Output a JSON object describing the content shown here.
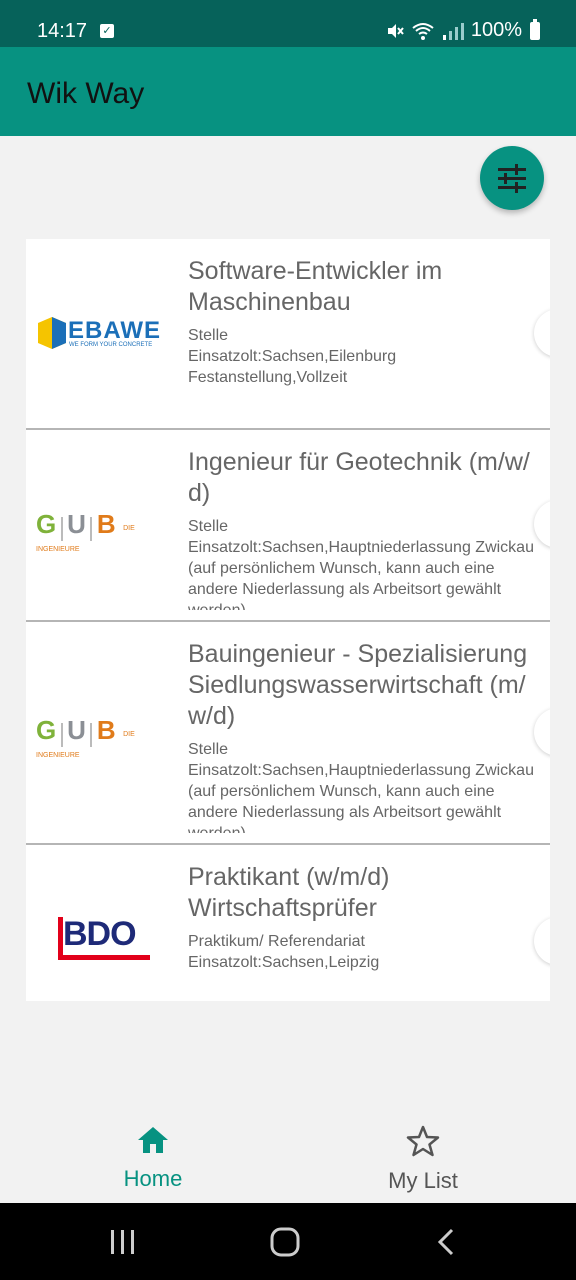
{
  "status": {
    "time": "14:17",
    "battery": "100%"
  },
  "app": {
    "title": "Wik Way"
  },
  "colors": {
    "primary": "#079281",
    "primary_dark": "#06625a"
  },
  "jobs": [
    {
      "title_lines": [
        "Software-Entwickler im",
        "Maschinenbau"
      ],
      "type": "Stelle",
      "location": "Einsatzolt:Sachsen,Eilenburg",
      "extra": [
        "Festanstellung,Vollzeit"
      ],
      "logo": {
        "name": "EBAWE",
        "tagline": "WE FORM YOUR CONCRETE"
      }
    },
    {
      "title_lines": [
        "Ingenieur für Geotechnik (m/w/",
        "d)"
      ],
      "type": "Stelle",
      "location": "Einsatzolt:Sachsen,Hauptniederlassung Zwickau",
      "extra": [
        "(auf persönlichem Wunsch, kann auch eine",
        "andere Niederlassung als Arbeitsort gewählt",
        "werden)"
      ],
      "logo": {
        "letters": [
          "G",
          "U",
          "B"
        ],
        "tagline": "DIE INGENIEURE"
      }
    },
    {
      "title_lines": [
        "Bauingenieur - Spezialisierung",
        "Siedlungswasserwirtschaft (m/",
        "w/d)"
      ],
      "type": "Stelle",
      "location": "Einsatzolt:Sachsen,Hauptniederlassung Zwickau",
      "extra": [
        "(auf persönlichem Wunsch, kann auch eine",
        "andere Niederlassung als Arbeitsort gewählt",
        "werden)"
      ],
      "logo": {
        "letters": [
          "G",
          "U",
          "B"
        ],
        "tagline": "DIE INGENIEURE"
      }
    },
    {
      "title_lines": [
        "Praktikant (w/m/d)",
        "Wirtschaftsprüfer"
      ],
      "type": "Praktikum/ Referendariat",
      "location": "Einsatzolt:Sachsen,Leipzig",
      "extra": [],
      "logo": {
        "name": "BDO"
      }
    }
  ],
  "nav": {
    "home": "Home",
    "my_list": "My List"
  }
}
